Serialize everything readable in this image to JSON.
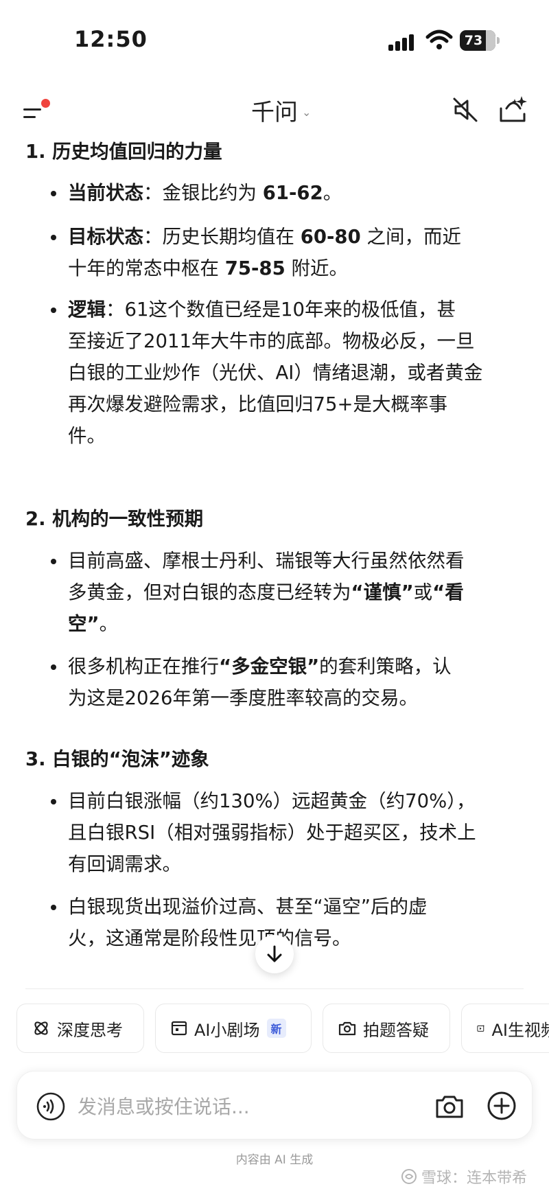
{
  "status_bar": {
    "time": "12:50",
    "battery": "73"
  },
  "header": {
    "title": "千问"
  },
  "sections": [
    {
      "heading": "1. 历史均值回归的力量",
      "items": [
        {
          "lines": [
            [
              {
                "t": "当前状态",
                "b": true
              },
              {
                "t": "：金银比约为 "
              },
              {
                "t": "61-62",
                "b": true
              },
              {
                "t": "。"
              }
            ]
          ]
        },
        {
          "lines": [
            [
              {
                "t": "目标状态",
                "b": true
              },
              {
                "t": "：历史长期均值在 "
              },
              {
                "t": "60-80",
                "b": true
              },
              {
                "t": " 之间，而近"
              }
            ],
            [
              {
                "t": "十年的常态中枢在 "
              },
              {
                "t": "75-85",
                "b": true
              },
              {
                "t": " 附近。"
              }
            ]
          ]
        },
        {
          "lines": [
            [
              {
                "t": "逻辑",
                "b": true
              },
              {
                "t": "：61这个数值已经是10年来的极低值，甚"
              }
            ],
            [
              {
                "t": "至接近了2011年大牛市的底部。物极必反，一旦"
              }
            ],
            [
              {
                "t": "白银的工业炒作（光伏、AI）情绪退潮，或者黄金"
              }
            ],
            [
              {
                "t": "再次爆发避险需求，比值回归75+是大概率事"
              }
            ],
            [
              {
                "t": "件。"
              }
            ]
          ]
        }
      ]
    },
    {
      "heading": "2. 机构的一致性预期",
      "items": [
        {
          "lines": [
            [
              {
                "t": "目前高盛、摩根士丹利、瑞银等大行虽然依然看"
              }
            ],
            [
              {
                "t": "多黄金，但对白银的态度已经转为"
              },
              {
                "t": "“谨慎”",
                "b": true
              },
              {
                "t": "或"
              },
              {
                "t": "“看",
                "b": true
              }
            ],
            [
              {
                "t": "空”",
                "b": true
              },
              {
                "t": "。"
              }
            ]
          ]
        },
        {
          "lines": [
            [
              {
                "t": "很多机构正在推行"
              },
              {
                "t": "“多金空银”",
                "b": true
              },
              {
                "t": "的套利策略，认"
              }
            ],
            [
              {
                "t": "为这是2026年第一季度胜率较高的交易。"
              }
            ]
          ]
        }
      ]
    },
    {
      "heading": "3. 白银的“泡沫”迹象",
      "items": [
        {
          "lines": [
            [
              {
                "t": "目前白银涨幅（约130%）远超黄金（约70%），"
              }
            ],
            [
              {
                "t": "且白银RSI（相对强弱指标）处于超买区，技术上"
              }
            ],
            [
              {
                "t": "有回调需求。"
              }
            ]
          ]
        },
        {
          "lines": [
            [
              {
                "t": "白银现货出现溢价过高、甚至“逼空”后的虚"
              }
            ],
            [
              {
                "t": "火，这通常是阶段性见顶的信号。"
              }
            ]
          ]
        }
      ]
    }
  ],
  "feature_chips": [
    {
      "label": "深度思考",
      "icon": "deep-think-icon"
    },
    {
      "label": "AI小剧场",
      "icon": "theater-icon",
      "badge": "新"
    },
    {
      "label": "拍题答疑",
      "icon": "photo-question-icon"
    },
    {
      "label": "AI生视频",
      "icon": "ai-video-icon"
    }
  ],
  "input": {
    "placeholder": "发消息或按住说话..."
  },
  "footer": {
    "disclaimer": "内容由 AI 生成",
    "watermark": "雪球：连本带希"
  }
}
